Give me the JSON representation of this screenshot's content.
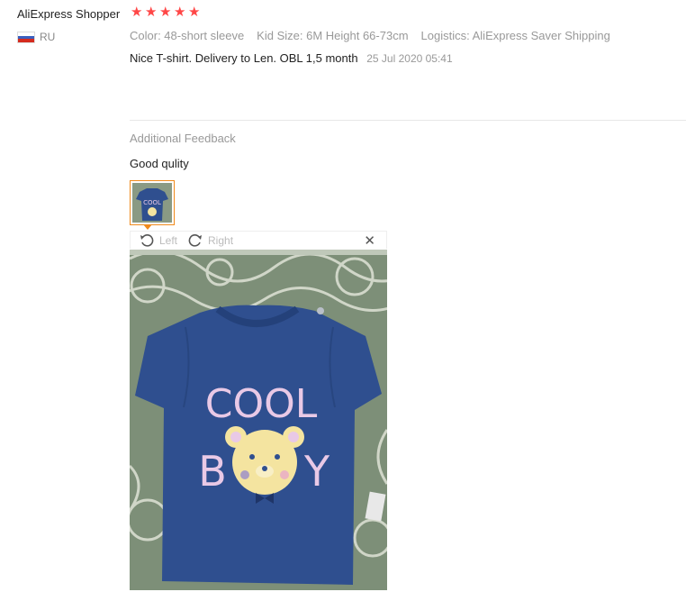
{
  "reviewer": {
    "name": "AliExpress Shopper",
    "country_code": "RU",
    "stars": 5
  },
  "attributes": {
    "color": "Color: 48-short sleeve",
    "kid_size": "Kid Size: 6M Height 66-73cm",
    "logistics": "Logistics: AliExpress Saver Shipping"
  },
  "review": {
    "text": "Nice T-shirt. Delivery to Len. OBL 1,5 month",
    "date": "25 Jul 2020 05:41"
  },
  "additional": {
    "title": "Additional Feedback",
    "text": "Good qulity"
  },
  "viewer": {
    "rotate_left_label": "Left",
    "rotate_right_label": "Right",
    "close_icon": "close-icon",
    "photo_text_top": "COOL",
    "photo_text_b": "B",
    "photo_text_y": "Y"
  },
  "colors": {
    "star": "#ff4747",
    "thumb_border": "#f08a1c",
    "shirt": "#2f4f8f",
    "print_pink": "#e9c9e6",
    "bear_yellow": "#f4e4a0"
  }
}
